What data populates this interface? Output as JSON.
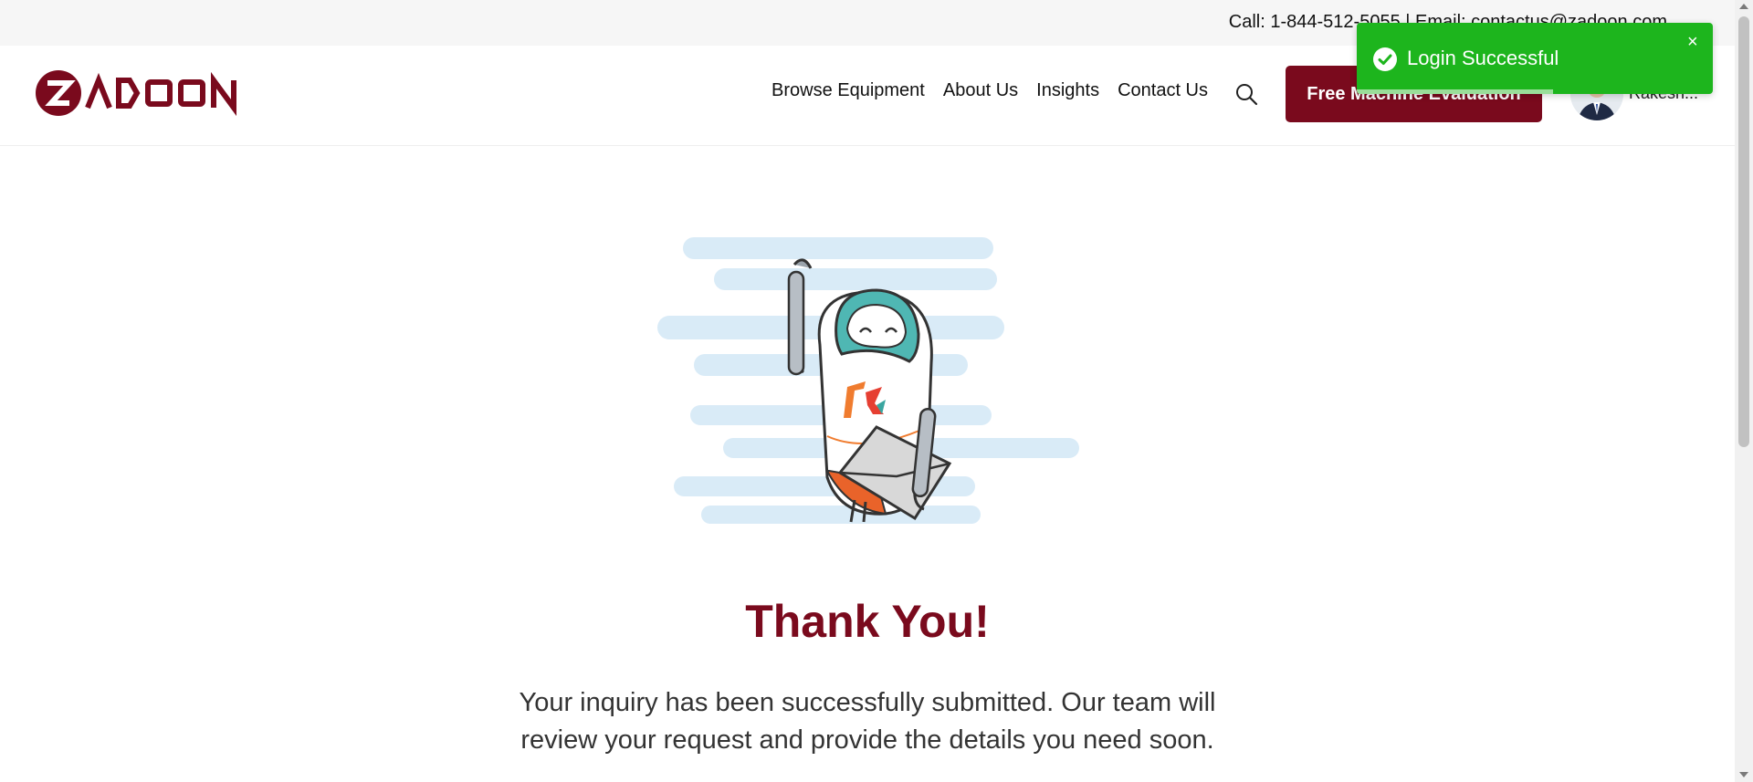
{
  "topbar": {
    "contact": "Call: 1-844-512-5055 | Email: contactus@zadoon.com"
  },
  "brand": {
    "name": "ZADOON",
    "color": "#7a0a1d"
  },
  "nav": {
    "items": [
      "Browse Equipment",
      "About Us",
      "Insights",
      "Contact Us"
    ],
    "search_icon": "search-icon"
  },
  "cta": {
    "label": "Free Machine Evaluation"
  },
  "user": {
    "name": "Rakesh..."
  },
  "main": {
    "title": "Thank You!",
    "message": "Your inquiry has been successfully submitted. Our team will review your request and provide the details you need soon."
  },
  "toast": {
    "text": "Login Successful",
    "close_symbol": "×",
    "color": "#1db51d",
    "progress": 0.55
  }
}
